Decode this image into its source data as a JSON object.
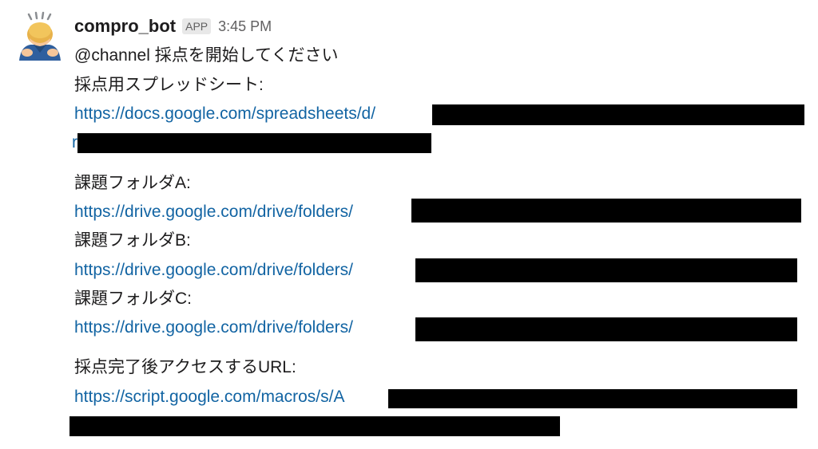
{
  "message": {
    "sender": "compro_bot",
    "app_badge": "APP",
    "timestamp": "3:45 PM",
    "avatar_icon": "person-bowing-emoji-icon",
    "lines": {
      "mention": "@channel 採点を開始してください",
      "spreadsheet_label": "採点用スプレッドシート:",
      "spreadsheet_url": "https://docs.google.com/spreadsheets/d/",
      "spreadsheet_url_wrap": "r",
      "folder_a_label": "課題フォルダA:",
      "folder_a_url": "https://drive.google.com/drive/folders/",
      "folder_b_label": "課題フォルダB:",
      "folder_b_url": "https://drive.google.com/drive/folders/",
      "folder_c_label": "課題フォルダC:",
      "folder_c_url": "https://drive.google.com/drive/folders/",
      "access_url_label": "採点完了後アクセスするURL:",
      "access_url": "https://script.google.com/macros/s/A"
    }
  },
  "colors": {
    "link": "#1264a3",
    "text": "#1d1c1d",
    "muted": "#616061",
    "redaction": "#000000"
  }
}
